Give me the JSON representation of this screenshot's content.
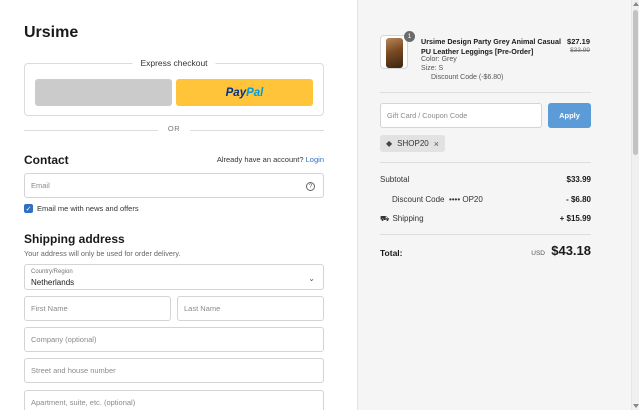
{
  "brand": {
    "name": "Ursime"
  },
  "express": {
    "label": "Express checkout",
    "paypal_part1": "Pay",
    "paypal_part2": "Pal"
  },
  "divider_text": "OR",
  "contact": {
    "title": "Contact",
    "login_prompt": "Already have an account?",
    "login_link": "Login",
    "email_placeholder": "Email",
    "newsletter_label": "Email me with news and offers",
    "newsletter_checked": true
  },
  "shipping": {
    "title": "Shipping address",
    "note": "Your address will only be used for order delivery.",
    "country_label": "Country/Region",
    "country_value": "Netherlands",
    "first_name_placeholder": "First Name",
    "last_name_placeholder": "Last Name",
    "company_placeholder": "Company (optional)",
    "street_placeholder": "Street and house number",
    "apartment_placeholder": "Apartment, suite, etc. (optional)"
  },
  "order": {
    "item": {
      "quantity": "1",
      "name": "Ursime Design Party Grey Animal Casual PU Leather Leggings [Pre-Order]",
      "color": "Color: Grey",
      "size": "Size: S",
      "discount": "Discount Code (-$6.80)",
      "price": "$27.19",
      "compare_price": "$33.99"
    },
    "coupon_placeholder": "Gift Card / Coupon Code",
    "apply_label": "Apply",
    "applied_code": "SHOP20",
    "subtotal_label": "Subtotal",
    "subtotal_value": "$33.99",
    "discount_label": "Discount Code",
    "discount_code_masked": "•••• OP20",
    "discount_value": "- $6.80",
    "shipping_label": "Shipping",
    "shipping_value": "+ $15.99",
    "total_label": "Total:",
    "total_currency": "USD",
    "total_value": "$43.18"
  },
  "colors": {
    "accent": "#2f6fc4",
    "apply_button": "#5a9bd8",
    "paypal_yellow": "#ffc439"
  }
}
